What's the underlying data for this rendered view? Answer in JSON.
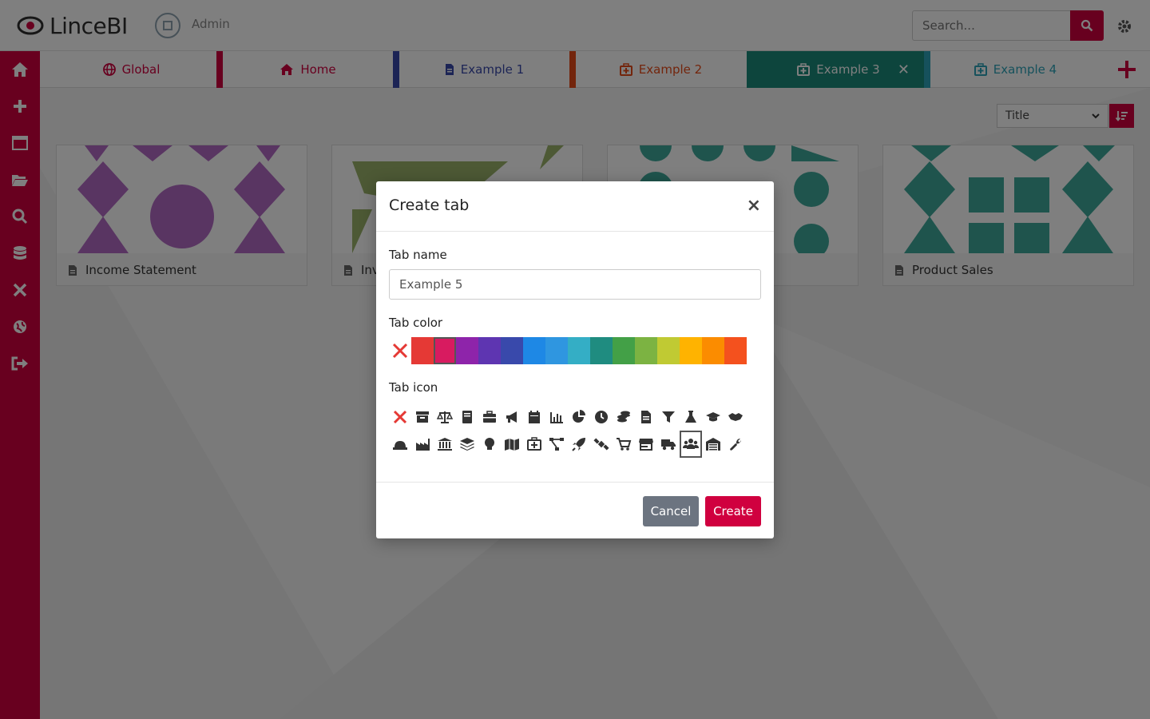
{
  "app": {
    "logo_text": "LinceBI",
    "user_name": "Admin"
  },
  "search": {
    "placeholder": "Search..."
  },
  "sidebar": {
    "items": [
      {
        "icon": "home-icon"
      },
      {
        "icon": "plus-icon"
      },
      {
        "icon": "window-icon"
      },
      {
        "icon": "folder-open-icon"
      },
      {
        "icon": "search-icon"
      },
      {
        "icon": "database-icon"
      },
      {
        "icon": "tools-icon"
      },
      {
        "icon": "globe-icon"
      },
      {
        "icon": "sign-out-icon"
      }
    ]
  },
  "tabs": [
    {
      "label": "Global",
      "color": "#d0003f",
      "icon": "globe-icon",
      "active": false
    },
    {
      "label": "Home",
      "color": "#d0003f",
      "icon": "home-icon",
      "active": false
    },
    {
      "label": "Example 1",
      "color": "#3949ab",
      "icon": "file-icon",
      "active": false
    },
    {
      "label": "Example 2",
      "color": "#e64a19",
      "icon": "medkit-icon",
      "active": false
    },
    {
      "label": "Example 3",
      "color": "#1a8a7a",
      "icon": "medkit-icon",
      "active": true
    },
    {
      "label": "Example 4",
      "color": "#2ca3b8",
      "icon": "medkit-icon",
      "active": false
    }
  ],
  "sort": {
    "selected": "Title"
  },
  "cards": [
    {
      "title": "Income Statement",
      "art_color": "#b36bc4"
    },
    {
      "title": "Inv",
      "art_color": "#9bb36b"
    },
    {
      "title": "",
      "art_color": "#3fa89a"
    },
    {
      "title": "Product Sales",
      "art_color": "#3fa89a"
    }
  ],
  "modal": {
    "title": "Create tab",
    "close": "×",
    "tab_name_label": "Tab name",
    "tab_name_value": "Example 5",
    "tab_color_label": "Tab color",
    "tab_icon_label": "Tab icon",
    "colors": [
      "#e53935",
      "#d81b60",
      "#8e24aa",
      "#5e35b1",
      "#3949ab",
      "#1e88e5",
      "#2f96e0",
      "#34aec5",
      "#1f8c80",
      "#43a047",
      "#7cb342",
      "#c0ca33",
      "#ffb300",
      "#fb8c00",
      "#f4511e"
    ],
    "selected_color": "#d81b60",
    "icons_row1": [
      "none",
      "archive",
      "balance-scale",
      "book",
      "briefcase",
      "bullhorn",
      "calendar",
      "bar-chart",
      "pie-chart",
      "clock",
      "coins",
      "file",
      "filter",
      "flask",
      "graduation-cap",
      "handshake"
    ],
    "icons_row2": [
      "hard-hat",
      "industry",
      "university",
      "layer-group",
      "lightbulb",
      "map",
      "medkit",
      "network",
      "rocket",
      "satellite",
      "shopping-cart",
      "store",
      "truck",
      "users",
      "warehouse",
      "wrench"
    ],
    "selected_icon": "users",
    "cancel_label": "Cancel",
    "create_label": "Create"
  }
}
